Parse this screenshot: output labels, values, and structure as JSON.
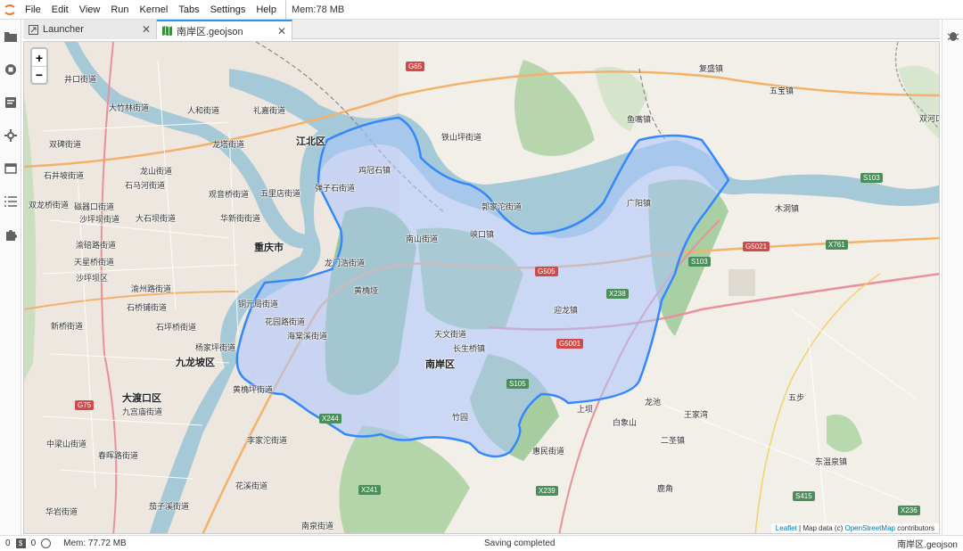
{
  "menubar": {
    "items": [
      "File",
      "Edit",
      "View",
      "Run",
      "Kernel",
      "Tabs",
      "Settings",
      "Help"
    ],
    "memory": "Mem:78 MB"
  },
  "tabs": [
    {
      "label": "Launcher",
      "icon": "launcher-icon",
      "active": false
    },
    {
      "label": "南岸区.geojson",
      "icon": "map-icon",
      "active": true
    }
  ],
  "leftbar": {
    "icons": [
      "folder-icon",
      "running-icon",
      "commands-icon",
      "property-inspector-icon",
      "tabs-icon",
      "toc-icon",
      "extension-icon"
    ]
  },
  "rightbar": {
    "icons": [
      "debugger-icon"
    ]
  },
  "map": {
    "zoom_in": "+",
    "zoom_out": "−",
    "attribution": {
      "leaflet": "Leaflet",
      "sep": " | Map data (c) ",
      "osm": "OpenStreetMap",
      "tail": " contributors"
    },
    "colors": {
      "water": "#a5c9d6",
      "boundary": "#3388ff",
      "fill": "#aac4ff",
      "park": "#8fbf8f",
      "urban": "#e8e3dc",
      "road": "#f4b16a"
    },
    "places": [
      {
        "id": "p1",
        "label": "井口街道"
      },
      {
        "id": "p2",
        "label": "大竹林街道"
      },
      {
        "id": "p3",
        "label": "人和街道"
      },
      {
        "id": "p4",
        "label": "礼嘉街道"
      },
      {
        "id": "p5",
        "label": "龙塔街道"
      },
      {
        "id": "p6",
        "label": "江北区"
      },
      {
        "id": "p7",
        "label": "双碑街道"
      },
      {
        "id": "p8",
        "label": "龙山街道"
      },
      {
        "id": "p9",
        "label": "石井坡街道"
      },
      {
        "id": "p10",
        "label": "石马河街道"
      },
      {
        "id": "p11",
        "label": "双龙桥街道"
      },
      {
        "id": "p12",
        "label": "观音桥街道"
      },
      {
        "id": "p13",
        "label": "五里店街道"
      },
      {
        "id": "p14",
        "label": "磁器口街道"
      },
      {
        "id": "p15",
        "label": "沙坪坝街道"
      },
      {
        "id": "p16",
        "label": "大石坝街道"
      },
      {
        "id": "p17",
        "label": "华新街街道"
      },
      {
        "id": "p18",
        "label": "重庆市"
      },
      {
        "id": "p19",
        "label": "渝碚路街道"
      },
      {
        "id": "p20",
        "label": "天星桥街道"
      },
      {
        "id": "p21",
        "label": "沙坪坝区"
      },
      {
        "id": "p22",
        "label": "渝州路街道"
      },
      {
        "id": "p23",
        "label": "石桥铺街道"
      },
      {
        "id": "p24",
        "label": "新桥街道"
      },
      {
        "id": "p25",
        "label": "石坪桥街道"
      },
      {
        "id": "p26",
        "label": "杨家坪街道"
      },
      {
        "id": "p27",
        "label": "九龙坡区"
      },
      {
        "id": "p28",
        "label": "大渡口区"
      },
      {
        "id": "p29",
        "label": "九宫庙街道"
      },
      {
        "id": "p30",
        "label": "黄桷坪街道"
      },
      {
        "id": "p31",
        "label": "中梁山街道"
      },
      {
        "id": "p32",
        "label": "春晖路街道"
      },
      {
        "id": "p33",
        "label": "李家沱街道"
      },
      {
        "id": "p34",
        "label": "花溪街道"
      },
      {
        "id": "p35",
        "label": "华岩街道"
      },
      {
        "id": "p36",
        "label": "茄子溪街道"
      },
      {
        "id": "p37",
        "label": "南泉街道"
      },
      {
        "id": "p38",
        "label": "鸡冠石镇"
      },
      {
        "id": "p39",
        "label": "弹子石街道"
      },
      {
        "id": "p40",
        "label": "铁山坪街道"
      },
      {
        "id": "p41",
        "label": "郭家沱街道"
      },
      {
        "id": "p42",
        "label": "南山街道"
      },
      {
        "id": "p43",
        "label": "峡口镇"
      },
      {
        "id": "p44",
        "label": "广阳镇"
      },
      {
        "id": "p45",
        "label": "龙门浩街道"
      },
      {
        "id": "p46",
        "label": "铜元局街道"
      },
      {
        "id": "p47",
        "label": "花园路街道"
      },
      {
        "id": "p48",
        "label": "海棠溪街道"
      },
      {
        "id": "p49",
        "label": "迎龙镇"
      },
      {
        "id": "p50",
        "label": "天文街道"
      },
      {
        "id": "p51",
        "label": "长生桥镇"
      },
      {
        "id": "p52",
        "label": "南岸区"
      },
      {
        "id": "p53",
        "label": "惠民街道"
      },
      {
        "id": "p54",
        "label": "复盛镇"
      },
      {
        "id": "p55",
        "label": "五宝镇"
      },
      {
        "id": "p56",
        "label": "鱼嘴镇"
      },
      {
        "id": "p57",
        "label": "双河口"
      },
      {
        "id": "p58",
        "label": "木洞镇"
      },
      {
        "id": "p59",
        "label": "二圣镇"
      },
      {
        "id": "p60",
        "label": "东温泉镇"
      },
      {
        "id": "p61",
        "label": "黄桷垭"
      },
      {
        "id": "p62",
        "label": "上坝"
      },
      {
        "id": "p63",
        "label": "龙池"
      },
      {
        "id": "p64",
        "label": "白象山"
      },
      {
        "id": "p65",
        "label": "王家湾"
      },
      {
        "id": "p66",
        "label": "竹园"
      },
      {
        "id": "p67",
        "label": "鹿角"
      },
      {
        "id": "p68",
        "label": "五步"
      }
    ],
    "roads": [
      {
        "id": "r1",
        "label": "G65"
      },
      {
        "id": "r2",
        "label": "G505"
      },
      {
        "id": "r3",
        "label": "X238"
      },
      {
        "id": "r4",
        "label": "G5001"
      },
      {
        "id": "r5",
        "label": "S105"
      },
      {
        "id": "r6",
        "label": "X244"
      },
      {
        "id": "r7",
        "label": "X241"
      },
      {
        "id": "r8",
        "label": "X239"
      },
      {
        "id": "r9",
        "label": "S103"
      },
      {
        "id": "r10",
        "label": "G5021"
      },
      {
        "id": "r11",
        "label": "X761"
      },
      {
        "id": "r12",
        "label": "S415"
      },
      {
        "id": "r13",
        "label": "X236"
      },
      {
        "id": "r14",
        "label": "G75"
      },
      {
        "id": "r15",
        "label": "S103"
      }
    ]
  },
  "statusbar": {
    "count_a": "0",
    "count_b": "0",
    "memory": "Mem: 77.72 MB",
    "status": "Saving completed",
    "file": "南岸区.geojson"
  }
}
